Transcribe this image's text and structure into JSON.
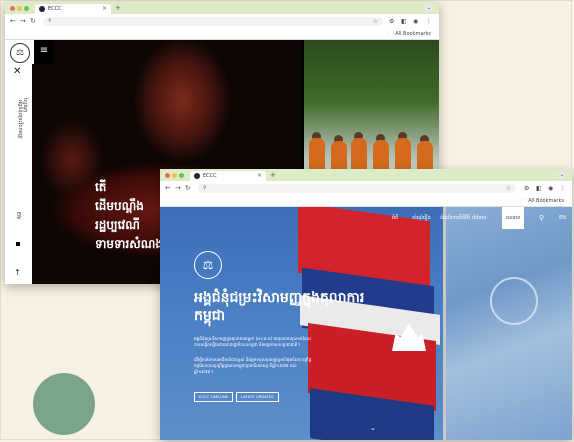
{
  "colors": {
    "background": "#f6f1e2",
    "circle": "#7aa58b",
    "chrome_bar": "#dcecc6",
    "dot_red": "#ec6a5e",
    "dot_yellow": "#f4bf4f",
    "dot_green": "#61c554",
    "nav_blue": "#1d3f7a"
  },
  "window1": {
    "tab_title": "ECCC",
    "bookmarks_label": "All Bookmarks",
    "side_vertical_1": "ស្វែងរក",
    "side_vertical_2": "អង្គជំនុំជម្រះវិសាមញ្ញ",
    "side_lang": "EN",
    "headline": [
      "តើ",
      "ដើមបណ្តឹង",
      "រដ្ឋប្បវេណី",
      "ទាមទារសំណង"
    ]
  },
  "window2": {
    "tab_title": "ECCC",
    "bookmarks_label": "All Bookmarks",
    "nav": {
      "items": [
        "អំពី",
        "សំណុំរឿង",
        "ដំណើរការនីតិវិធី",
        "ព័ត៌មាន",
        "ធនធាន"
      ],
      "lang": "EN"
    },
    "title_lines": [
      "អង្គជំនុំជម្រះវិសាមញ្ញក្នុងតុលាការ",
      "កម្ពុជា"
    ],
    "para1": "អង្គជំនុំជម្រះវិសាមញ្ញក្នុងតុលាការកម្ពុជា (អ.វ.ត.ក) ជាតុលាការកូនកាត់ដែលបានបង្កើតឡើងដោយរាជរដ្ឋាភិបាលកម្ពុជា និងអង្គការសហប្រជាជាតិ។",
    "para2": "ដើម្បីកាត់ទោសមេដឹកនាំជាន់ខ្ពស់ និងអ្នកទទួលខុសត្រូវខ្ពស់បំផុតចំពោះឧក្រិដ្ឋកម្មដែលបានប្រព្រឹត្តក្នុងរបបកម្ពុជាប្រជាធិបតេយ្យ ពីឆ្នាំ១៩៧៥ ដល់ឆ្នាំ១៩៧៩។",
    "buttons": [
      "ECCC TIMELINE",
      "LATEST UPDATES"
    ]
  }
}
